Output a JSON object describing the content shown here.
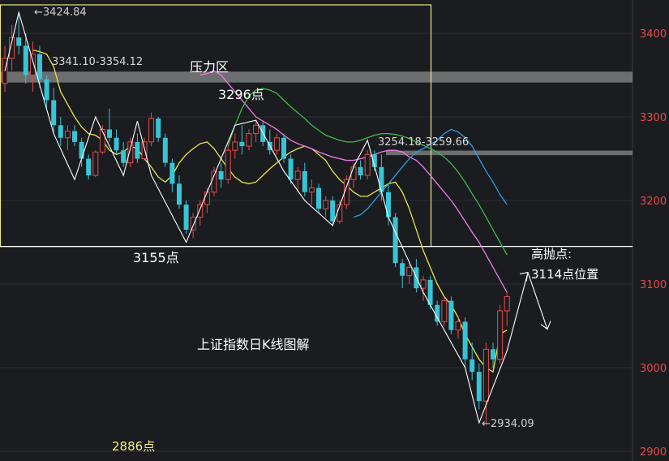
{
  "chart_data": {
    "type": "candlestick",
    "title": "上证指数日K线图解",
    "y_axis": {
      "ticks": [
        2900,
        3000,
        3100,
        3200,
        3300,
        3400
      ],
      "tick_labels": [
        "2900",
        "3000",
        "3100",
        "3200",
        "3300",
        "3400"
      ],
      "range": [
        2890,
        3445
      ]
    },
    "candles": [
      [
        3340,
        3385,
        3330,
        3370
      ],
      [
        3370,
        3410,
        3355,
        3395
      ],
      [
        3395,
        3425,
        3375,
        3385
      ],
      [
        3385,
        3400,
        3340,
        3350
      ],
      [
        3350,
        3390,
        3330,
        3375
      ],
      [
        3375,
        3385,
        3335,
        3345
      ],
      [
        3345,
        3350,
        3310,
        3320
      ],
      [
        3320,
        3335,
        3280,
        3290
      ],
      [
        3290,
        3300,
        3265,
        3275
      ],
      [
        3275,
        3290,
        3260,
        3283
      ],
      [
        3283,
        3290,
        3265,
        3270
      ],
      [
        3270,
        3275,
        3240,
        3250
      ],
      [
        3250,
        3255,
        3225,
        3230
      ],
      [
        3230,
        3260,
        3228,
        3258
      ],
      [
        3258,
        3290,
        3255,
        3285
      ],
      [
        3285,
        3310,
        3270,
        3275
      ],
      [
        3275,
        3285,
        3255,
        3260
      ],
      [
        3260,
        3270,
        3240,
        3245
      ],
      [
        3245,
        3275,
        3240,
        3270
      ],
      [
        3270,
        3280,
        3245,
        3250
      ],
      [
        3250,
        3275,
        3248,
        3270
      ],
      [
        3270,
        3305,
        3265,
        3298
      ],
      [
        3298,
        3300,
        3270,
        3275
      ],
      [
        3275,
        3280,
        3240,
        3245
      ],
      [
        3245,
        3250,
        3210,
        3220
      ],
      [
        3220,
        3230,
        3190,
        3195
      ],
      [
        3195,
        3200,
        3160,
        3165
      ],
      [
        3165,
        3185,
        3155,
        3180
      ],
      [
        3180,
        3200,
        3170,
        3195
      ],
      [
        3195,
        3215,
        3185,
        3210
      ],
      [
        3210,
        3240,
        3205,
        3235
      ],
      [
        3235,
        3245,
        3215,
        3225
      ],
      [
        3225,
        3265,
        3220,
        3260
      ],
      [
        3260,
        3280,
        3250,
        3270
      ],
      [
        3270,
        3290,
        3255,
        3265
      ],
      [
        3265,
        3285,
        3260,
        3280
      ],
      [
        3280,
        3296,
        3270,
        3290
      ],
      [
        3290,
        3295,
        3265,
        3270
      ],
      [
        3270,
        3285,
        3255,
        3260
      ],
      [
        3260,
        3280,
        3255,
        3275
      ],
      [
        3275,
        3280,
        3245,
        3250
      ],
      [
        3250,
        3255,
        3220,
        3225
      ],
      [
        3225,
        3240,
        3210,
        3235
      ],
      [
        3235,
        3245,
        3205,
        3210
      ],
      [
        3210,
        3225,
        3195,
        3215
      ],
      [
        3215,
        3220,
        3185,
        3190
      ],
      [
        3190,
        3205,
        3180,
        3200
      ],
      [
        3200,
        3205,
        3170,
        3175
      ],
      [
        3175,
        3200,
        3172,
        3195
      ],
      [
        3195,
        3230,
        3190,
        3225
      ],
      [
        3225,
        3245,
        3215,
        3240
      ],
      [
        3240,
        3248,
        3225,
        3230
      ],
      [
        3230,
        3260,
        3225,
        3255
      ],
      [
        3255,
        3260,
        3235,
        3240
      ],
      [
        3240,
        3255,
        3200,
        3210
      ],
      [
        3210,
        3220,
        3170,
        3180
      ],
      [
        3180,
        3185,
        3120,
        3125
      ],
      [
        3125,
        3130,
        3095,
        3110
      ],
      [
        3110,
        3125,
        3100,
        3120
      ],
      [
        3120,
        3130,
        3090,
        3095
      ],
      [
        3095,
        3110,
        3080,
        3105
      ],
      [
        3105,
        3110,
        3070,
        3075
      ],
      [
        3075,
        3080,
        3050,
        3055
      ],
      [
        3055,
        3085,
        3050,
        3080
      ],
      [
        3080,
        3085,
        3040,
        3045
      ],
      [
        3045,
        3060,
        3035,
        3055
      ],
      [
        3055,
        3060,
        3000,
        3010
      ],
      [
        3010,
        3030,
        2985,
        2995
      ],
      [
        2995,
        3005,
        2950,
        2960
      ],
      [
        2960,
        3030,
        2934,
        3022
      ],
      [
        3022,
        3030,
        3000,
        3010
      ],
      [
        3010,
        3075,
        3005,
        3068
      ],
      [
        3068,
        3090,
        3050,
        3085
      ]
    ],
    "moving_averages": [
      {
        "color": "#e8e54a",
        "values": [
          3380,
          3378,
          3375,
          3360,
          3330,
          3315,
          3300,
          3288,
          3280,
          3278,
          3272,
          3260,
          3255,
          3258,
          3265,
          3262,
          3250,
          3240,
          3228,
          3222,
          3230,
          3245,
          3255,
          3262,
          3268,
          3270,
          3262,
          3250,
          3238,
          3228,
          3222,
          3220,
          3222,
          3230,
          3238,
          3245,
          3252,
          3258,
          3262,
          3265,
          3262,
          3255,
          3248,
          3235,
          3225,
          3218,
          3210,
          3205,
          3205,
          3210,
          3215,
          3220,
          3222,
          3210,
          3190,
          3165,
          3140,
          3120,
          3100,
          3085,
          3075,
          3060,
          3040,
          3025,
          3010,
          3000,
          2995,
          3040,
          3045
        ]
      },
      {
        "color": "#f07ce5",
        "values": [
          3350,
          3352,
          3355,
          3350,
          3340,
          3330,
          3320,
          3310,
          3300,
          3295,
          3290,
          3285,
          3278,
          3272,
          3268,
          3265,
          3262,
          3258,
          3255,
          3252,
          3250,
          3248,
          3248,
          3250,
          3252,
          3255,
          3258,
          3260,
          3260,
          3258,
          3252,
          3248,
          3240,
          3230,
          3220,
          3210,
          3200,
          3188,
          3175,
          3162,
          3150,
          3135,
          3120,
          3105,
          3090
        ]
      },
      {
        "color": "#3dbb4a",
        "values": [
          3265,
          3290,
          3310,
          3325,
          3332,
          3334,
          3332,
          3328,
          3320,
          3312,
          3305,
          3298,
          3290,
          3284,
          3278,
          3275,
          3272,
          3270,
          3270,
          3272,
          3275,
          3278,
          3280,
          3280,
          3279,
          3277,
          3274,
          3270,
          3266,
          3262,
          3258,
          3252,
          3244,
          3234,
          3222,
          3208,
          3195,
          3180,
          3165,
          3150,
          3135
        ]
      },
      {
        "color": "#2a9ee0",
        "values": [
          3180,
          3183,
          3190,
          3200,
          3210,
          3220,
          3230,
          3240,
          3250,
          3258,
          3262,
          3267,
          3272,
          3280,
          3285,
          3282,
          3275,
          3265,
          3250,
          3235,
          3222,
          3207,
          3195
        ]
      }
    ],
    "horizontal_bands": [
      {
        "label": "3341.10-3354.12",
        "low": 3341.1,
        "high": 3354.12,
        "name": "压力区"
      },
      {
        "label": "3254.18-3259.66",
        "low": 3254.18,
        "high": 3259.66
      }
    ],
    "box": {
      "high": 3434,
      "low": 3145
    },
    "annotations": {
      "max_label": "3424.84",
      "min_label": "2934.09",
      "pressure_zone": "压力区",
      "band_label_1": "3341.10-3354.12",
      "band_label_2": "3254.18-3259.66",
      "peak_label": "3296点",
      "trough_label": "3155点",
      "target_label_line1": "高抛点:",
      "target_label_line2": "3114点位置",
      "chart_title": "上证指数日K线图解",
      "bottom_label": "2886点"
    },
    "colors": {
      "up": "#e84a4a",
      "down": "#36c5d6",
      "axis_text": "#e84a4a",
      "box": "#e8e58a",
      "background": "#1b1c20"
    }
  }
}
